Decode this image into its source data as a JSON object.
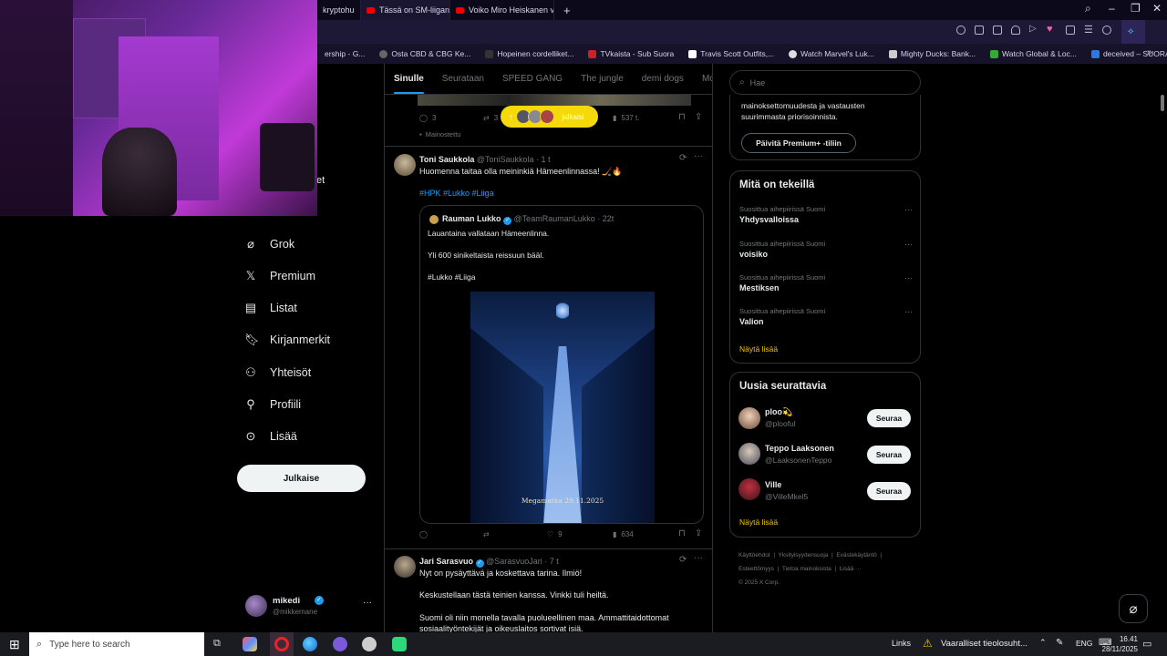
{
  "browser": {
    "tabs": [
      {
        "label": "kryptohu"
      },
      {
        "label": "Tässä on SM-liigan uusi s"
      },
      {
        "label": "Voiko Miro Heiskanen voi"
      }
    ],
    "new_tab": "+",
    "bookmarks": [
      "ership - G...",
      "Osta CBD & CBG Ke...",
      "Hopeinen cordelliket...",
      "TVkaista - Sub Suora",
      "Travis Scott Outfits,...",
      "Watch Marvel's Luk...",
      "Mighty Ducks: Bank...",
      "Watch Global & Loc...",
      "deceived – SUORAT..."
    ]
  },
  "nav": {
    "partial_top": "et",
    "items": [
      {
        "label": "Grok",
        "icon": "grok-icon"
      },
      {
        "label": "Premium",
        "icon": "x-logo-icon"
      },
      {
        "label": "Listat",
        "icon": "list-icon"
      },
      {
        "label": "Kirjanmerkit",
        "icon": "bookmark-icon"
      },
      {
        "label": "Yhteisöt",
        "icon": "communities-icon"
      },
      {
        "label": "Profiili",
        "icon": "profile-icon"
      },
      {
        "label": "Lisää",
        "icon": "more-circle-icon"
      }
    ],
    "post_button": "Julkaise",
    "account": {
      "name": "mikedi",
      "handle": "@mikkemane",
      "more": "···"
    }
  },
  "feed": {
    "tabs": [
      "Sinulle",
      "Seurataan",
      "SPEED GANG",
      "The jungle",
      "demi dogs",
      "McDonal"
    ],
    "active_tab": "Sinulle",
    "ad_post": {
      "replies": "3",
      "reposts": "3",
      "views": "537 t.",
      "promoted": "Mainostettu",
      "new_posts_label": "julkaisi"
    },
    "post1": {
      "name": "Toni Saukkola",
      "handle": "@ToniSaukkola",
      "time": "· 1 t",
      "text": "Huomenna taitaa olla meininkiä Hämeenlinnassa! 🏒🔥",
      "hashtags": "#HPK #Lukko #Liiga",
      "quote": {
        "name": "Rauman Lukko",
        "handle": "@TeamRaumanLukko",
        "time": "· 22t",
        "line1": "Lauantaina vallataan Hämeenlinna.",
        "line2": "Yli 600 sinikeltaista reissuun bääl.",
        "line3": "#Lukko #Liiga",
        "image_caption": "Megamatka 29.11.2025"
      },
      "replies": "",
      "reposts": "",
      "likes": "9",
      "views": "634"
    },
    "post2": {
      "name": "Jari Sarasvuo",
      "handle": "@SarasvuoJari",
      "time": "· 7 t",
      "line1": "Nyt on pysäyttävä ja koskettava tarina. Ilmiö!",
      "line2": "Keskustellaan tästä teinien kanssa. Vinkki tuli heiltä.",
      "line3": "Suomi oli niin monella tavalla puolueellinen maa. Ammattitaidottomat sosiaalityöntekijät ja oikeuslaitos sortivat isiä."
    }
  },
  "right": {
    "search_placeholder": "Hae",
    "premium": {
      "text_partial": "mainoksettomuudesta ja vastausten suurimmasta priorisoinnista.",
      "button": "Päivitä Premium+ -tiliin"
    },
    "trends_title": "Mitä on tekeillä",
    "trends": [
      {
        "context": "Suosittua aihepiirissä Suomi",
        "name": "Yhdysvalloissa"
      },
      {
        "context": "Suosittua aihepiirissä Suomi",
        "name": "voisiko"
      },
      {
        "context": "Suosittua aihepiirissä Suomi",
        "name": "Mestiksen"
      },
      {
        "context": "Suosittua aihepiirissä Suomi",
        "name": "Valion"
      }
    ],
    "show_more": "Näytä lisää",
    "who_title": "Uusia seurattavia",
    "who": [
      {
        "name": "ploo💫",
        "handle": "@plooful",
        "button": "Seuraa"
      },
      {
        "name": "Teppo Laaksonen",
        "handle": "@LaaksonenTeppo",
        "button": "Seuraa"
      },
      {
        "name": "Ville",
        "handle": "@VilleMkel5",
        "button": "Seuraa"
      }
    ],
    "who_show_more": "Näytä lisää",
    "footer": [
      "Käyttöehdot",
      "Yksityisyydensuoja",
      "Evästekäytäntö",
      "Esteettömyys",
      "Tietoa mainoksista",
      "Lisää ···",
      "© 2025 X Corp."
    ]
  },
  "taskbar": {
    "search_placeholder": "Type here to search",
    "links": "Links",
    "warning": "Vaaralliset tieolosuht...",
    "lang": "ENG",
    "time": "16.41",
    "date": "28/11/2025"
  },
  "colors": {
    "accent": "#1d9bf0",
    "bg": "#000000",
    "border": "#2f3336",
    "muted": "#71767b",
    "browser": "#1c1836"
  }
}
